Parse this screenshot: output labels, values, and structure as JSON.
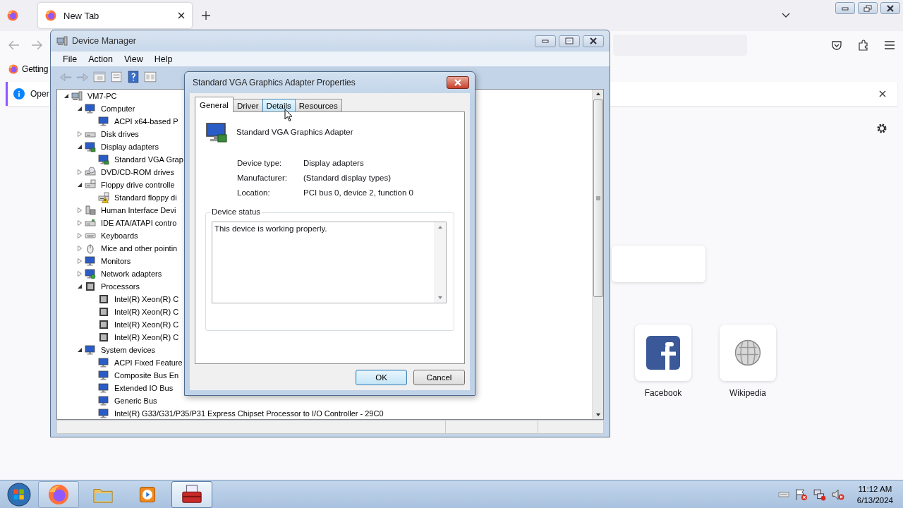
{
  "browser": {
    "tabs": [
      {
        "label": "New Tab",
        "selected": true
      }
    ],
    "bookmarks": [
      {
        "label": "Getting"
      }
    ],
    "notification": {
      "text": "Oper"
    },
    "shortcuts": [
      {
        "label": "Facebook",
        "kind": "facebook"
      },
      {
        "label": "Wikipedia",
        "kind": "wikipedia"
      }
    ]
  },
  "device_manager": {
    "title": "Device Manager",
    "menu": [
      "File",
      "Action",
      "View",
      "Help"
    ],
    "tree": {
      "label": "VM7-PC",
      "kind": "pc",
      "expanded": true,
      "children": [
        {
          "label": "Computer",
          "kind": "computer",
          "expanded": true,
          "children": [
            {
              "label": "ACPI x64-based P",
              "kind": "computer"
            }
          ]
        },
        {
          "label": "Disk drives",
          "kind": "disk",
          "expanded": false
        },
        {
          "label": "Display adapters",
          "kind": "display",
          "expanded": true,
          "children": [
            {
              "label": "Standard VGA Grap",
              "kind": "display"
            }
          ]
        },
        {
          "label": "DVD/CD-ROM drives",
          "kind": "dvd",
          "expanded": false
        },
        {
          "label": "Floppy drive controlle",
          "kind": "floppy",
          "expanded": true,
          "children": [
            {
              "label": "Standard floppy di",
              "kind": "floppy",
              "warning": true
            }
          ]
        },
        {
          "label": "Human Interface Devi",
          "kind": "hid",
          "expanded": false
        },
        {
          "label": "IDE ATA/ATAPI contro",
          "kind": "ide",
          "expanded": false
        },
        {
          "label": "Keyboards",
          "kind": "keyboard",
          "expanded": false
        },
        {
          "label": "Mice and other pointin",
          "kind": "mouse",
          "expanded": false
        },
        {
          "label": "Monitors",
          "kind": "monitor",
          "expanded": false
        },
        {
          "label": "Network adapters",
          "kind": "network",
          "expanded": false
        },
        {
          "label": "Processors",
          "kind": "cpu",
          "expanded": true,
          "children": [
            {
              "label": "Intel(R) Xeon(R) C",
              "kind": "cpu"
            },
            {
              "label": "Intel(R) Xeon(R) C",
              "kind": "cpu"
            },
            {
              "label": "Intel(R) Xeon(R) C",
              "kind": "cpu"
            },
            {
              "label": "Intel(R) Xeon(R) C",
              "kind": "cpu"
            }
          ]
        },
        {
          "label": "System devices",
          "kind": "system",
          "expanded": true,
          "children": [
            {
              "label": "ACPI Fixed Feature",
              "kind": "system"
            },
            {
              "label": "Composite Bus En",
              "kind": "system"
            },
            {
              "label": "Extended IO Bus",
              "kind": "system"
            },
            {
              "label": "Generic Bus",
              "kind": "system"
            },
            {
              "label": "Intel(R) G33/G31/P35/P31 Express Chipset Processor to I/O Controller - 29C0",
              "kind": "system"
            }
          ]
        }
      ]
    }
  },
  "properties_dialog": {
    "title": "Standard VGA Graphics Adapter Properties",
    "tabs": [
      {
        "label": "General",
        "selected": true,
        "hovered": false
      },
      {
        "label": "Driver",
        "selected": false,
        "hovered": false
      },
      {
        "label": "Details",
        "selected": false,
        "hovered": true
      },
      {
        "label": "Resources",
        "selected": false,
        "hovered": false
      }
    ],
    "device_name": "Standard VGA Graphics Adapter",
    "properties": [
      {
        "label": "Device type:",
        "value": "Display adapters"
      },
      {
        "label": "Manufacturer:",
        "value": "(Standard display types)"
      },
      {
        "label": "Location:",
        "value": "PCI bus 0, device 2, function 0"
      }
    ],
    "status_group": "Device status",
    "status_text": "This device is working properly.",
    "buttons": [
      {
        "label": "OK",
        "default": true
      },
      {
        "label": "Cancel",
        "default": false
      }
    ]
  },
  "taskbar": {
    "apps": [
      {
        "kind": "browser",
        "running": true,
        "selected": false
      },
      {
        "kind": "folder",
        "running": false,
        "selected": false
      },
      {
        "kind": "media",
        "running": false,
        "selected": false
      },
      {
        "kind": "toolbox",
        "running": true,
        "selected": true
      }
    ],
    "time": "11:12 AM",
    "date": "6/13/2024"
  }
}
